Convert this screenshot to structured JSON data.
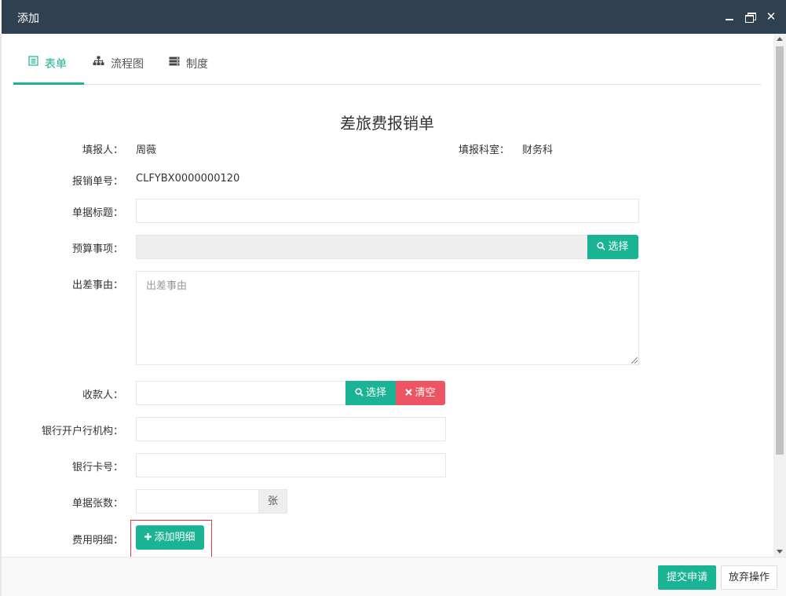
{
  "window": {
    "title": "添加",
    "close_glyph": "✕"
  },
  "tabs": [
    {
      "label": "表单",
      "icon": "form-icon",
      "active": true
    },
    {
      "label": "流程图",
      "icon": "sitemap-icon",
      "active": false
    },
    {
      "label": "制度",
      "icon": "server-icon",
      "active": false
    }
  ],
  "form": {
    "title": "差旅费报销单",
    "filler_label": "填报人：",
    "filler_value": "周薇",
    "dept_label": "填报科室：",
    "dept_value": "财务科",
    "number_label": "报销单号：",
    "number_value": "CLFYBX0000000120",
    "doc_title_label": "单据标题：",
    "doc_title_value": "",
    "budget_label": "预算事项：",
    "budget_value": "",
    "budget_select": "选择",
    "reason_label": "出差事由：",
    "reason_placeholder": "出差事由",
    "payee_label": "收款人：",
    "payee_value": "",
    "payee_select": "选择",
    "payee_clear": "清空",
    "bank_label": "银行开户行机构：",
    "bank_value": "",
    "card_label": "银行卡号：",
    "card_value": "",
    "doc_count_label": "单据张数：",
    "doc_count_value": "",
    "doc_count_unit": "张",
    "detail_label": "费用明细：",
    "add_detail": "添加明细"
  },
  "footer": {
    "submit": "提交申请",
    "cancel": "放弃操作"
  },
  "colors": {
    "titlebar": "#2f4050",
    "primary": "#1ab394",
    "danger": "#ed5565",
    "highlight_box": "#e4393c"
  }
}
